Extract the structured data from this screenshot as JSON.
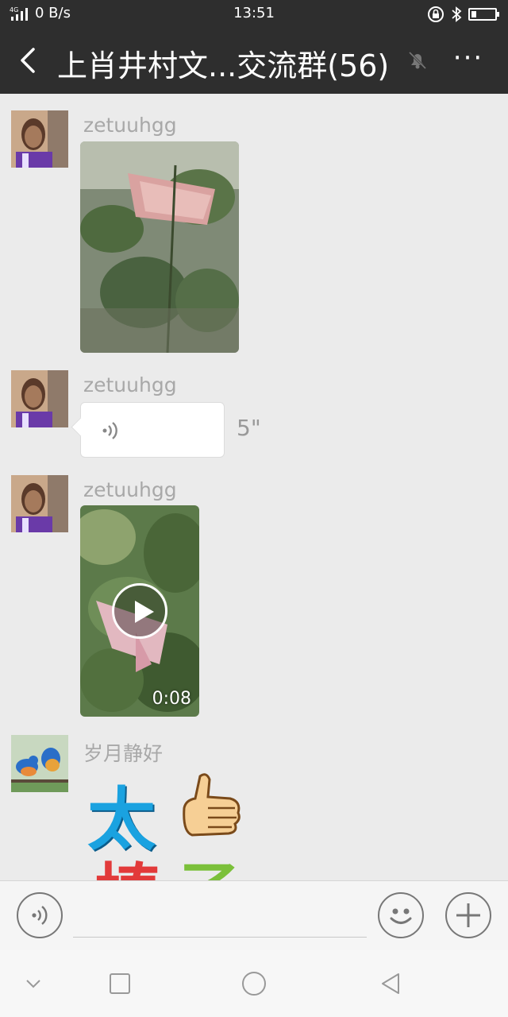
{
  "status_bar": {
    "network": "4G",
    "speed": "0 B/s",
    "time": "13:51",
    "icons": [
      "signal-icon",
      "lock-rotation-icon",
      "bluetooth-icon",
      "battery-icon"
    ]
  },
  "header": {
    "title": "上肖井村文...交流群(56)",
    "back_icon": "chevron-left-icon",
    "mute_icon": "bell-off-icon",
    "more_icon": "more-icon",
    "more_label": "···"
  },
  "messages": [
    {
      "sender": "zetuuhgg",
      "type": "image"
    },
    {
      "sender": "zetuuhgg",
      "type": "voice",
      "duration": "5\""
    },
    {
      "sender": "zetuuhgg",
      "type": "video",
      "duration": "0:08"
    },
    {
      "sender": "岁月静好",
      "type": "sticker",
      "sticker_text": [
        "太",
        "棒",
        "了"
      ]
    }
  ],
  "input_bar": {
    "voice_icon": "voice-icon",
    "emoji_icon": "emoji-icon",
    "plus_icon": "plus-icon",
    "placeholder": ""
  },
  "nav_bar": {
    "icons": [
      "chevron-down-icon",
      "square-icon",
      "circle-icon",
      "triangle-back-icon"
    ]
  },
  "colors": {
    "header_bg": "#2e2e2e",
    "chat_bg": "#ebebeb",
    "sender_text": "#a8a8a8"
  }
}
